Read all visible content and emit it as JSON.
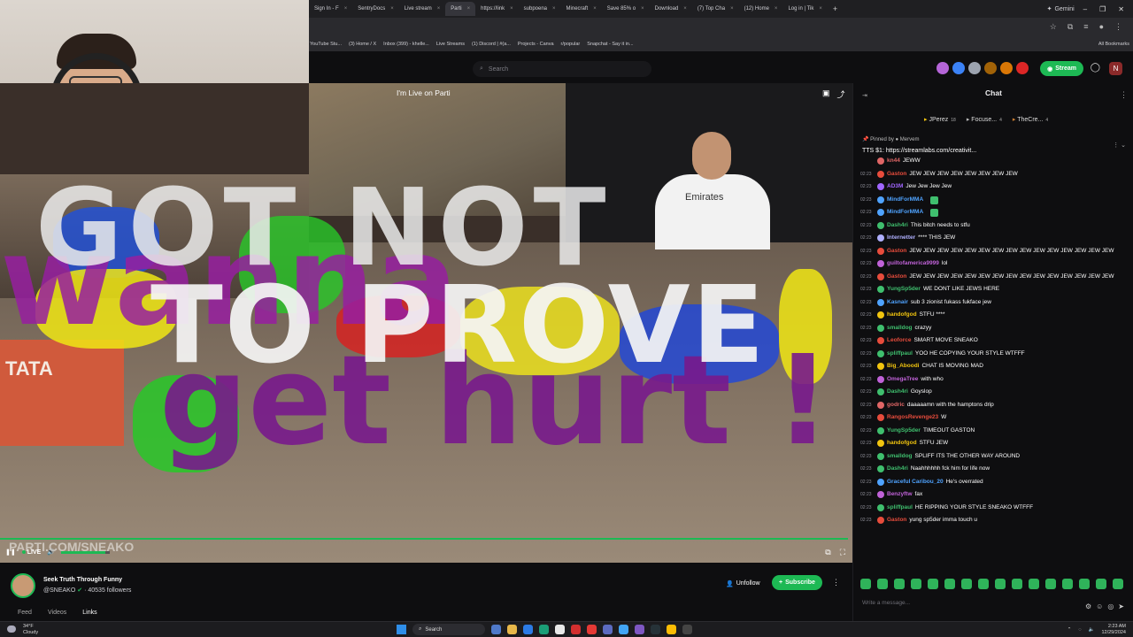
{
  "browser": {
    "tabs": [
      {
        "label": "Sign In - F",
        "active": false
      },
      {
        "label": "SentryDocs",
        "active": false
      },
      {
        "label": "Live stream",
        "active": false
      },
      {
        "label": "Parti",
        "active": true
      },
      {
        "label": "https://link",
        "active": false
      },
      {
        "label": "subpoena",
        "active": false
      },
      {
        "label": "Minecraft",
        "active": false
      },
      {
        "label": "Save 85% o",
        "active": false
      },
      {
        "label": "Download",
        "active": false
      },
      {
        "label": "(7) Top Cha",
        "active": false
      },
      {
        "label": "(12) Home",
        "active": false
      },
      {
        "label": "Log in | Tik",
        "active": false
      }
    ],
    "new_tab": "+",
    "gemini_label": "Gemini",
    "bookmarks": [
      "YouTube Stu...",
      "(3) Home / X",
      "Inbox (399) - khelle...",
      "Live Streams",
      "(1) Discord | #(a...",
      "Projects - Canva",
      "r/popular",
      "Snapchat - Say it in..."
    ],
    "all_bookmarks": "All Bookmarks"
  },
  "site_header": {
    "search_placeholder": "Search",
    "stream_button": "Stream"
  },
  "video": {
    "title": "I'm Live on Parti",
    "overlay_lines": [
      "GOT NOT",
      "wanna",
      "TO PROVE",
      "get hurt !"
    ],
    "banner_text": "TATA",
    "jersey_text": "Emirates",
    "watermark": "PARTI.COM/SNEAKO",
    "live_label": "LIVE",
    "volume_level": 0.9
  },
  "channel": {
    "title": "Seek Truth Through Funny",
    "handle": "@SNEAKO",
    "followers": "40535 followers",
    "tabs": [
      "Feed",
      "Videos",
      "Links"
    ],
    "unfollow_label": "Unfollow",
    "subscribe_label": "Subscribe"
  },
  "chat": {
    "title": "Chat",
    "top_chatters": [
      {
        "name": "JPerez",
        "count": "18"
      },
      {
        "name": "Focuse...",
        "count": "4"
      },
      {
        "name": "TheCre...",
        "count": "4"
      }
    ],
    "pinned_by": "Pinned by ● Mervem",
    "pinned_message": "TTS $1: https://streamlabs.com/creativit...",
    "messages": [
      {
        "ts": "",
        "user": "kn44",
        "color": "#e06666",
        "text": "JEWW"
      },
      {
        "ts": "02:23",
        "user": "Gaston",
        "color": "#e74c3c",
        "text": "JEW JEW JEW JEW JEW JEW JEW JEW"
      },
      {
        "ts": "02:23",
        "user": "AD3M",
        "color": "#a066ff",
        "text": "Jew Jew Jew Jew"
      },
      {
        "ts": "02:23",
        "user": "MindForMMA",
        "color": "#4fa3ff",
        "text": ""
      },
      {
        "ts": "02:23",
        "user": "MindForMMA",
        "color": "#4fa3ff",
        "text": ""
      },
      {
        "ts": "02:23",
        "user": "Dash4ri",
        "color": "#3fbf6e",
        "text": "This bitch needs to stfu"
      },
      {
        "ts": "02:23",
        "user": "Internetter",
        "color": "#b0b0ff",
        "text": "**** THIS JEW"
      },
      {
        "ts": "02:23",
        "user": "Gaston",
        "color": "#e74c3c",
        "text": "JEW JEW JEW JEW JEW JEW JEW JEW JEW JEW JEW JEW JEW JEW JEW"
      },
      {
        "ts": "02:23",
        "user": "guiltofamerica9999",
        "color": "#c062d8",
        "text": "lol"
      },
      {
        "ts": "02:23",
        "user": "Gaston",
        "color": "#e74c3c",
        "text": "JEW JEW JEW JEW JEW JEW JEW JEW JEW JEW JEW JEW JEW JEW JEW"
      },
      {
        "ts": "02:23",
        "user": "YungSp5der",
        "color": "#3fbf6e",
        "text": "WE DONT LIKE JEWS HERE"
      },
      {
        "ts": "02:23",
        "user": "Kasnair",
        "color": "#4fa3ff",
        "text": "sub 3 zionist fukass fukface jew"
      },
      {
        "ts": "02:23",
        "user": "handofgod",
        "color": "#f1c40f",
        "text": "STFU ****"
      },
      {
        "ts": "02:23",
        "user": "smalldog",
        "color": "#3fbf6e",
        "text": "crazyy"
      },
      {
        "ts": "02:23",
        "user": "Leoforce",
        "color": "#e74c3c",
        "text": "SMART MOVE SNEAKO"
      },
      {
        "ts": "02:23",
        "user": "spliffpaul",
        "color": "#3fbf6e",
        "text": "YOO HE COPYING YOUR STYLE WTFFF"
      },
      {
        "ts": "02:23",
        "user": "Big_Aboodi",
        "color": "#f1c40f",
        "text": "CHAT IS MOVING MAD"
      },
      {
        "ts": "02:23",
        "user": "OmegaTree",
        "color": "#c062d8",
        "text": "with who"
      },
      {
        "ts": "02:23",
        "user": "Dash4ri",
        "color": "#3fbf6e",
        "text": "Goyslop"
      },
      {
        "ts": "02:23",
        "user": "godric",
        "color": "#e06666",
        "text": "daaaaamn with the hamptons drip"
      },
      {
        "ts": "02:23",
        "user": "RangosRevenge23",
        "color": "#e74c3c",
        "text": "W"
      },
      {
        "ts": "02:23",
        "user": "YungSp5der",
        "color": "#3fbf6e",
        "text": "TIMEOUT GASTON"
      },
      {
        "ts": "02:23",
        "user": "handofgod",
        "color": "#f1c40f",
        "text": "STFU JEW"
      },
      {
        "ts": "02:23",
        "user": "smalldog",
        "color": "#3fbf6e",
        "text": "SPLIFF ITS THE OTHER WAY AROUND"
      },
      {
        "ts": "02:23",
        "user": "Dash4ri",
        "color": "#3fbf6e",
        "text": "Naahhhhhh fck him for life now"
      },
      {
        "ts": "02:23",
        "user": "Graceful Caribou_20",
        "color": "#4fa3ff",
        "text": "He's overrated"
      },
      {
        "ts": "02:23",
        "user": "Benzyftw",
        "color": "#c062d8",
        "text": "fax"
      },
      {
        "ts": "02:23",
        "user": "spliffpaul",
        "color": "#3fbf6e",
        "text": "HE RIPPING YOUR STYLE SNEAKO WTFFF"
      },
      {
        "ts": "02:23",
        "user": "Gaston",
        "color": "#e74c3c",
        "text": "yung sp5der imma touch u"
      }
    ],
    "input_placeholder": "Write a message..."
  },
  "taskbar": {
    "temperature": "34°F",
    "weather": "Cloudy",
    "search_label": "Search",
    "time": "2:23 AM",
    "date": "12/29/2024"
  },
  "colors": {
    "accent": "#1db954",
    "bg": "#0e0e10"
  }
}
